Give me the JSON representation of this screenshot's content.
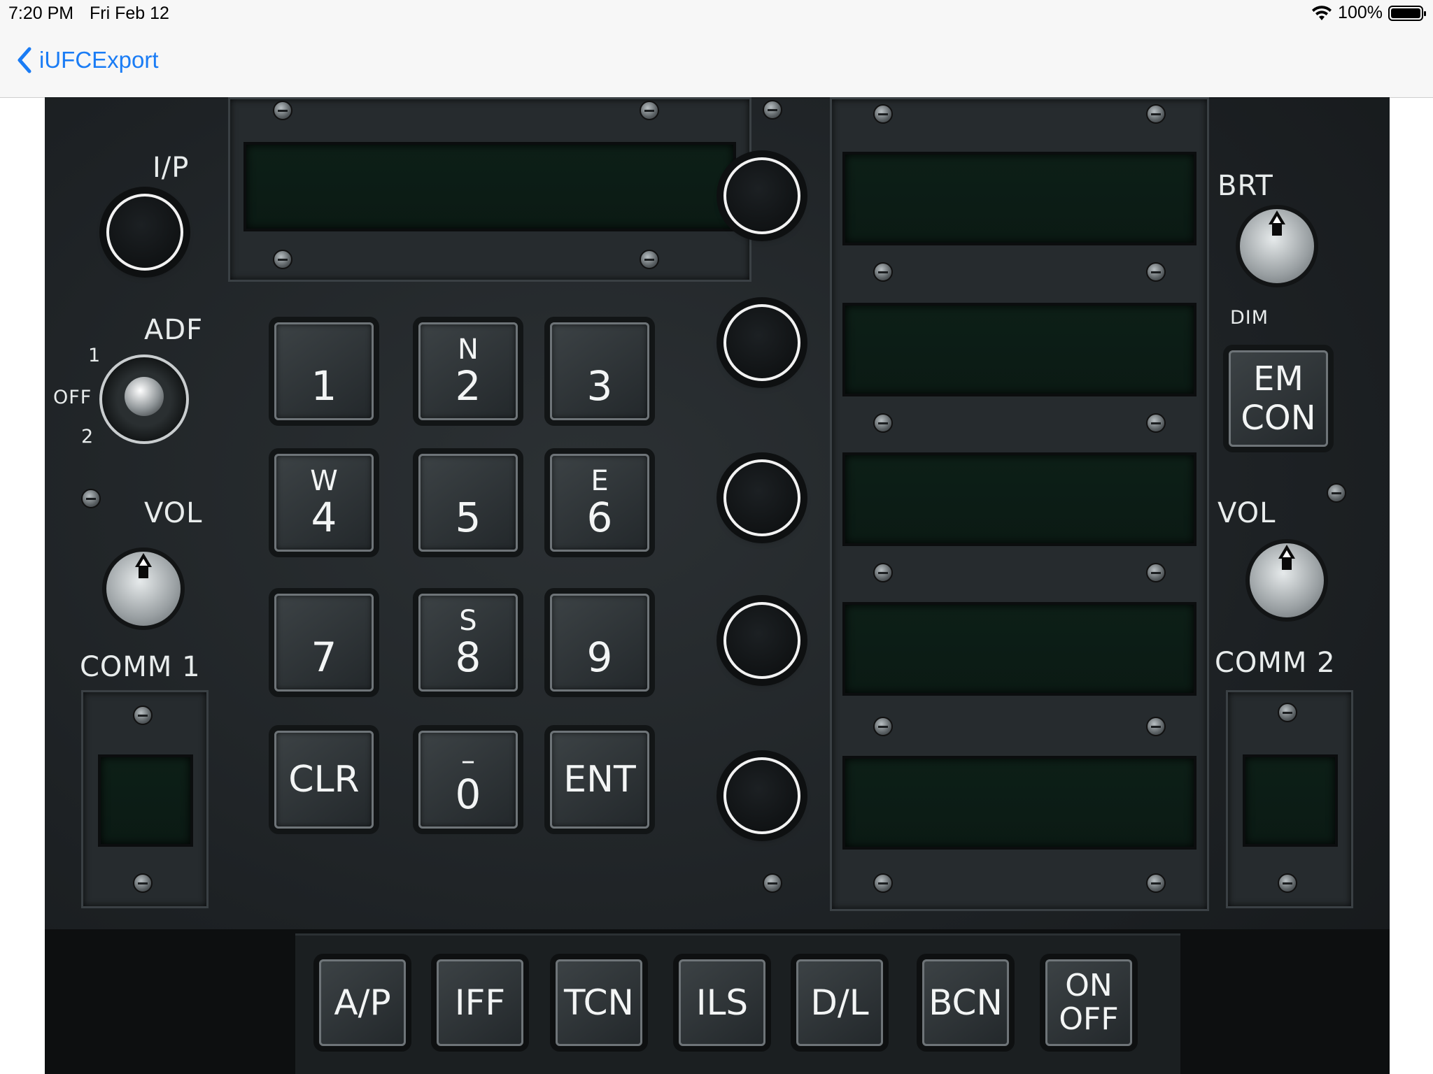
{
  "status_bar": {
    "time": "7:20 PM",
    "date": "Fri Feb 12",
    "battery": "100%",
    "battery_level": 1.0
  },
  "nav": {
    "back_label": "iUFCExport"
  },
  "panel": {
    "left": {
      "ip_label": "I/P",
      "adf_label": "ADF",
      "adf_positions": [
        "1",
        "OFF",
        "2"
      ],
      "vol_label": "VOL",
      "comm_label": "COMM 1"
    },
    "keypad": [
      {
        "alt": "",
        "main": "1"
      },
      {
        "alt": "N",
        "main": "2"
      },
      {
        "alt": "",
        "main": "3"
      },
      {
        "alt": "W",
        "main": "4"
      },
      {
        "alt": "",
        "main": "5"
      },
      {
        "alt": "E",
        "main": "6"
      },
      {
        "alt": "",
        "main": "7"
      },
      {
        "alt": "S",
        "main": "8"
      },
      {
        "alt": "",
        "main": "9"
      },
      {
        "alt": "",
        "main": "CLR"
      },
      {
        "alt": "–",
        "main": "0"
      },
      {
        "alt": "",
        "main": "ENT"
      }
    ],
    "right": {
      "brt_label": "BRT",
      "dim_label": "DIM",
      "em_con_label": [
        "EM",
        "CON"
      ],
      "vol_label": "VOL",
      "comm_label": "COMM 2"
    },
    "bottom_buttons": [
      "A/P",
      "IFF",
      "TCN",
      "ILS",
      "D/L",
      "BCN",
      [
        "ON",
        "OFF"
      ]
    ]
  },
  "colors": {
    "ios_blue": "#1a7cf5",
    "display_green": "#0d1f17",
    "panel": "#1d2124"
  }
}
